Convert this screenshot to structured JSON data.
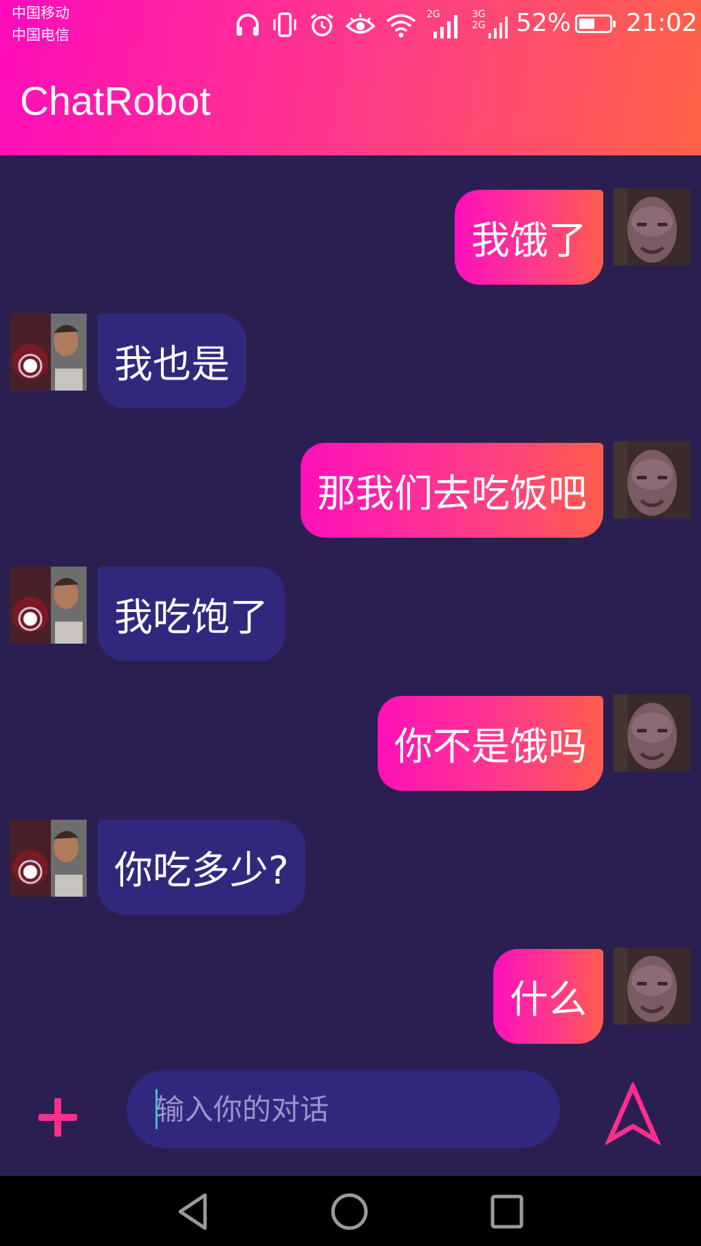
{
  "status_bar": {
    "carrier_1": "中国移动",
    "carrier_2": "中国电信",
    "network_1": "2G",
    "network_2a": "3G",
    "network_2b": "2G",
    "battery_percent": "52%",
    "battery_level": 0.52,
    "time": "21:02",
    "icons": [
      "headphones-icon",
      "vibrate-icon",
      "alarm-icon",
      "eye-icon",
      "wifi-icon",
      "signal-icon",
      "signal-icon",
      "battery-icon"
    ]
  },
  "app": {
    "title": "ChatRobot"
  },
  "messages": [
    {
      "sender": "me",
      "text": "我饿了"
    },
    {
      "sender": "bot",
      "text": "我也是"
    },
    {
      "sender": "me",
      "text": "那我们去吃饭吧"
    },
    {
      "sender": "bot",
      "text": "我吃饱了"
    },
    {
      "sender": "me",
      "text": "你不是饿吗"
    },
    {
      "sender": "bot",
      "text": "你吃多少?"
    },
    {
      "sender": "me",
      "text": "什么"
    }
  ],
  "input": {
    "placeholder": "输入你的对话",
    "value": ""
  },
  "colors": {
    "header_start": "#ff0cbb",
    "header_end": "#ff6346",
    "background": "#2b1f52",
    "bot_bubble": "#31287e",
    "accent": "#ff2e8e"
  }
}
